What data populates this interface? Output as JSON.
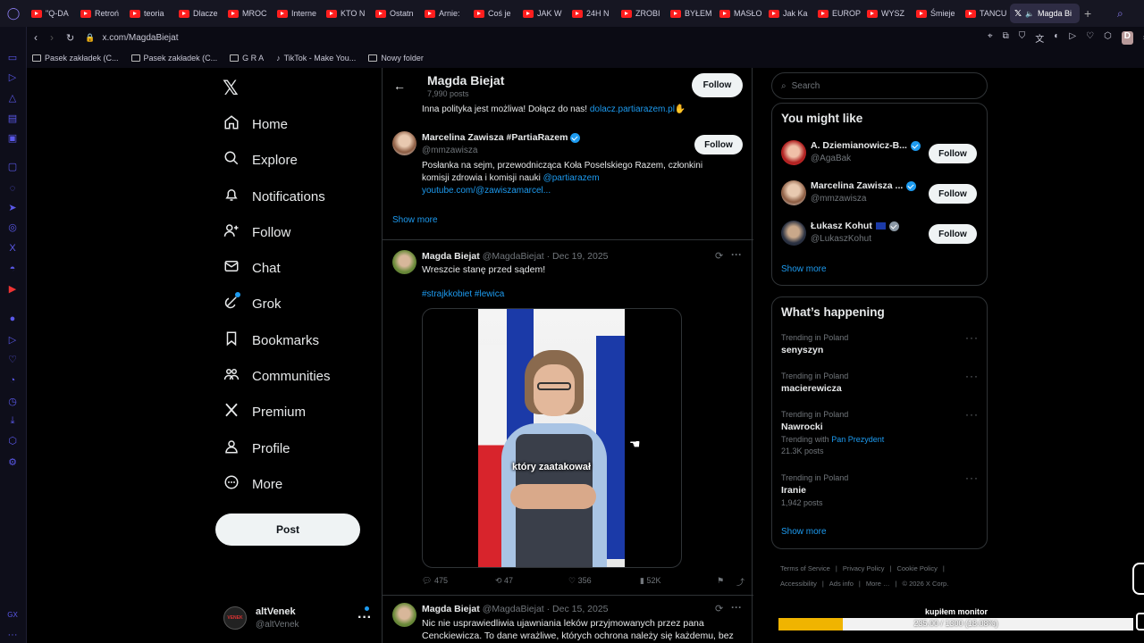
{
  "browser": {
    "tabs": [
      "\"Q-DA",
      "Retroń",
      "teoria",
      "Dlacze",
      "MROC",
      "Interne",
      "KTO N",
      "Ostatn",
      "Arnie:",
      "Coś je",
      "JAK W",
      "24H N",
      "ZROBI",
      "BYŁEM",
      "MASŁO",
      "Jak Ka",
      "EUROP",
      "WYSZ",
      "Śmieje",
      "TANCU"
    ],
    "active_tab": "Magda Bi",
    "url": "x.com/MagdaBiejat",
    "bookmarks": [
      "Pasek zakładek (C...",
      "Pasek zakładek (C...",
      "G R A",
      "TikTok - Make You...",
      "Nowy folder"
    ],
    "profile_initial": "D"
  },
  "nav": {
    "items": [
      "Home",
      "Explore",
      "Notifications",
      "Follow",
      "Chat",
      "Grok",
      "Bookmarks",
      "Communities",
      "Premium",
      "Profile",
      "More"
    ],
    "post": "Post"
  },
  "account": {
    "name": "altVenek",
    "handle": "@altVenek",
    "avatar_text": "VENEK"
  },
  "header": {
    "name": "Magda Biejat",
    "posts": "7,990 posts",
    "follow": "Follow"
  },
  "bio_tail": {
    "text": "Inna polityka jest możliwa! Dołącz do nas! ",
    "link": "dolacz.partiarazem.pl"
  },
  "suggested": {
    "name": "Marcelina Zawisza #PartiaRazem",
    "handle": "@mmzawisza",
    "follow": "Follow",
    "bio": "Posłanka na sejm, przewodnicząca Koła Poselskiego Razem, członkini komisji zdrowia i komisji nauki ",
    "bio_link": "@partiarazem",
    "bio_link2": "youtube.com/@zawiszamarcel...",
    "show_more": "Show more"
  },
  "tweet1": {
    "name": "Magda Biejat",
    "meta": "@MagdaBiejat · Dec 19, 2025",
    "text": "Wreszcie stanę przed sądem!",
    "tags": "#strajkkobiet #lewica",
    "caption": "który zaatakował",
    "replies": "475",
    "reposts": "47",
    "likes": "356",
    "views": "52K"
  },
  "tweet2": {
    "name": "Magda Biejat",
    "meta": "@MagdaBiejat · Dec 15, 2025",
    "text1": "Nic nie usprawiedliwia ujawniania leków przyjmowanych przez pana",
    "text2": "Cenckiewicza. To dane wrażliwe, których ochrona należy się każdemu, bez"
  },
  "search": {
    "placeholder": "Search"
  },
  "might_like": {
    "title": "You might like",
    "people": [
      {
        "name": "A. Dziemianowicz-B...",
        "handle": "@AgaBak",
        "follow": "Follow"
      },
      {
        "name": "Marcelina Zawisza ...",
        "handle": "@mmzawisza",
        "follow": "Follow"
      },
      {
        "name": "Łukasz Kohut",
        "handle": "@LukaszKohut",
        "follow": "Follow"
      }
    ],
    "show_more": "Show more"
  },
  "happening": {
    "title": "What’s happening",
    "trends": [
      {
        "label": "Trending in Poland",
        "topic": "senyszyn",
        "extra": ""
      },
      {
        "label": "Trending in Poland",
        "topic": "macierewicza",
        "extra": ""
      },
      {
        "label": "Trending in Poland",
        "topic": "Nawrocki",
        "with": "Trending with",
        "with_link": "Pan Prezydent",
        "extra": "21.3K posts"
      },
      {
        "label": "Trending in Poland",
        "topic": "Iranie",
        "extra": "1,942 posts"
      }
    ],
    "show_more": "Show more"
  },
  "footer": [
    "Terms of Service",
    "Privacy Policy",
    "Cookie Policy",
    "Accessibility",
    "Ads info",
    "More …",
    "© 2026 X Corp."
  ],
  "overlay": {
    "title": "kupiłem monitor",
    "progress_text": "235.00 / 1300 (18.08%)",
    "progress": 0.1808,
    "color": "#f0b400"
  }
}
